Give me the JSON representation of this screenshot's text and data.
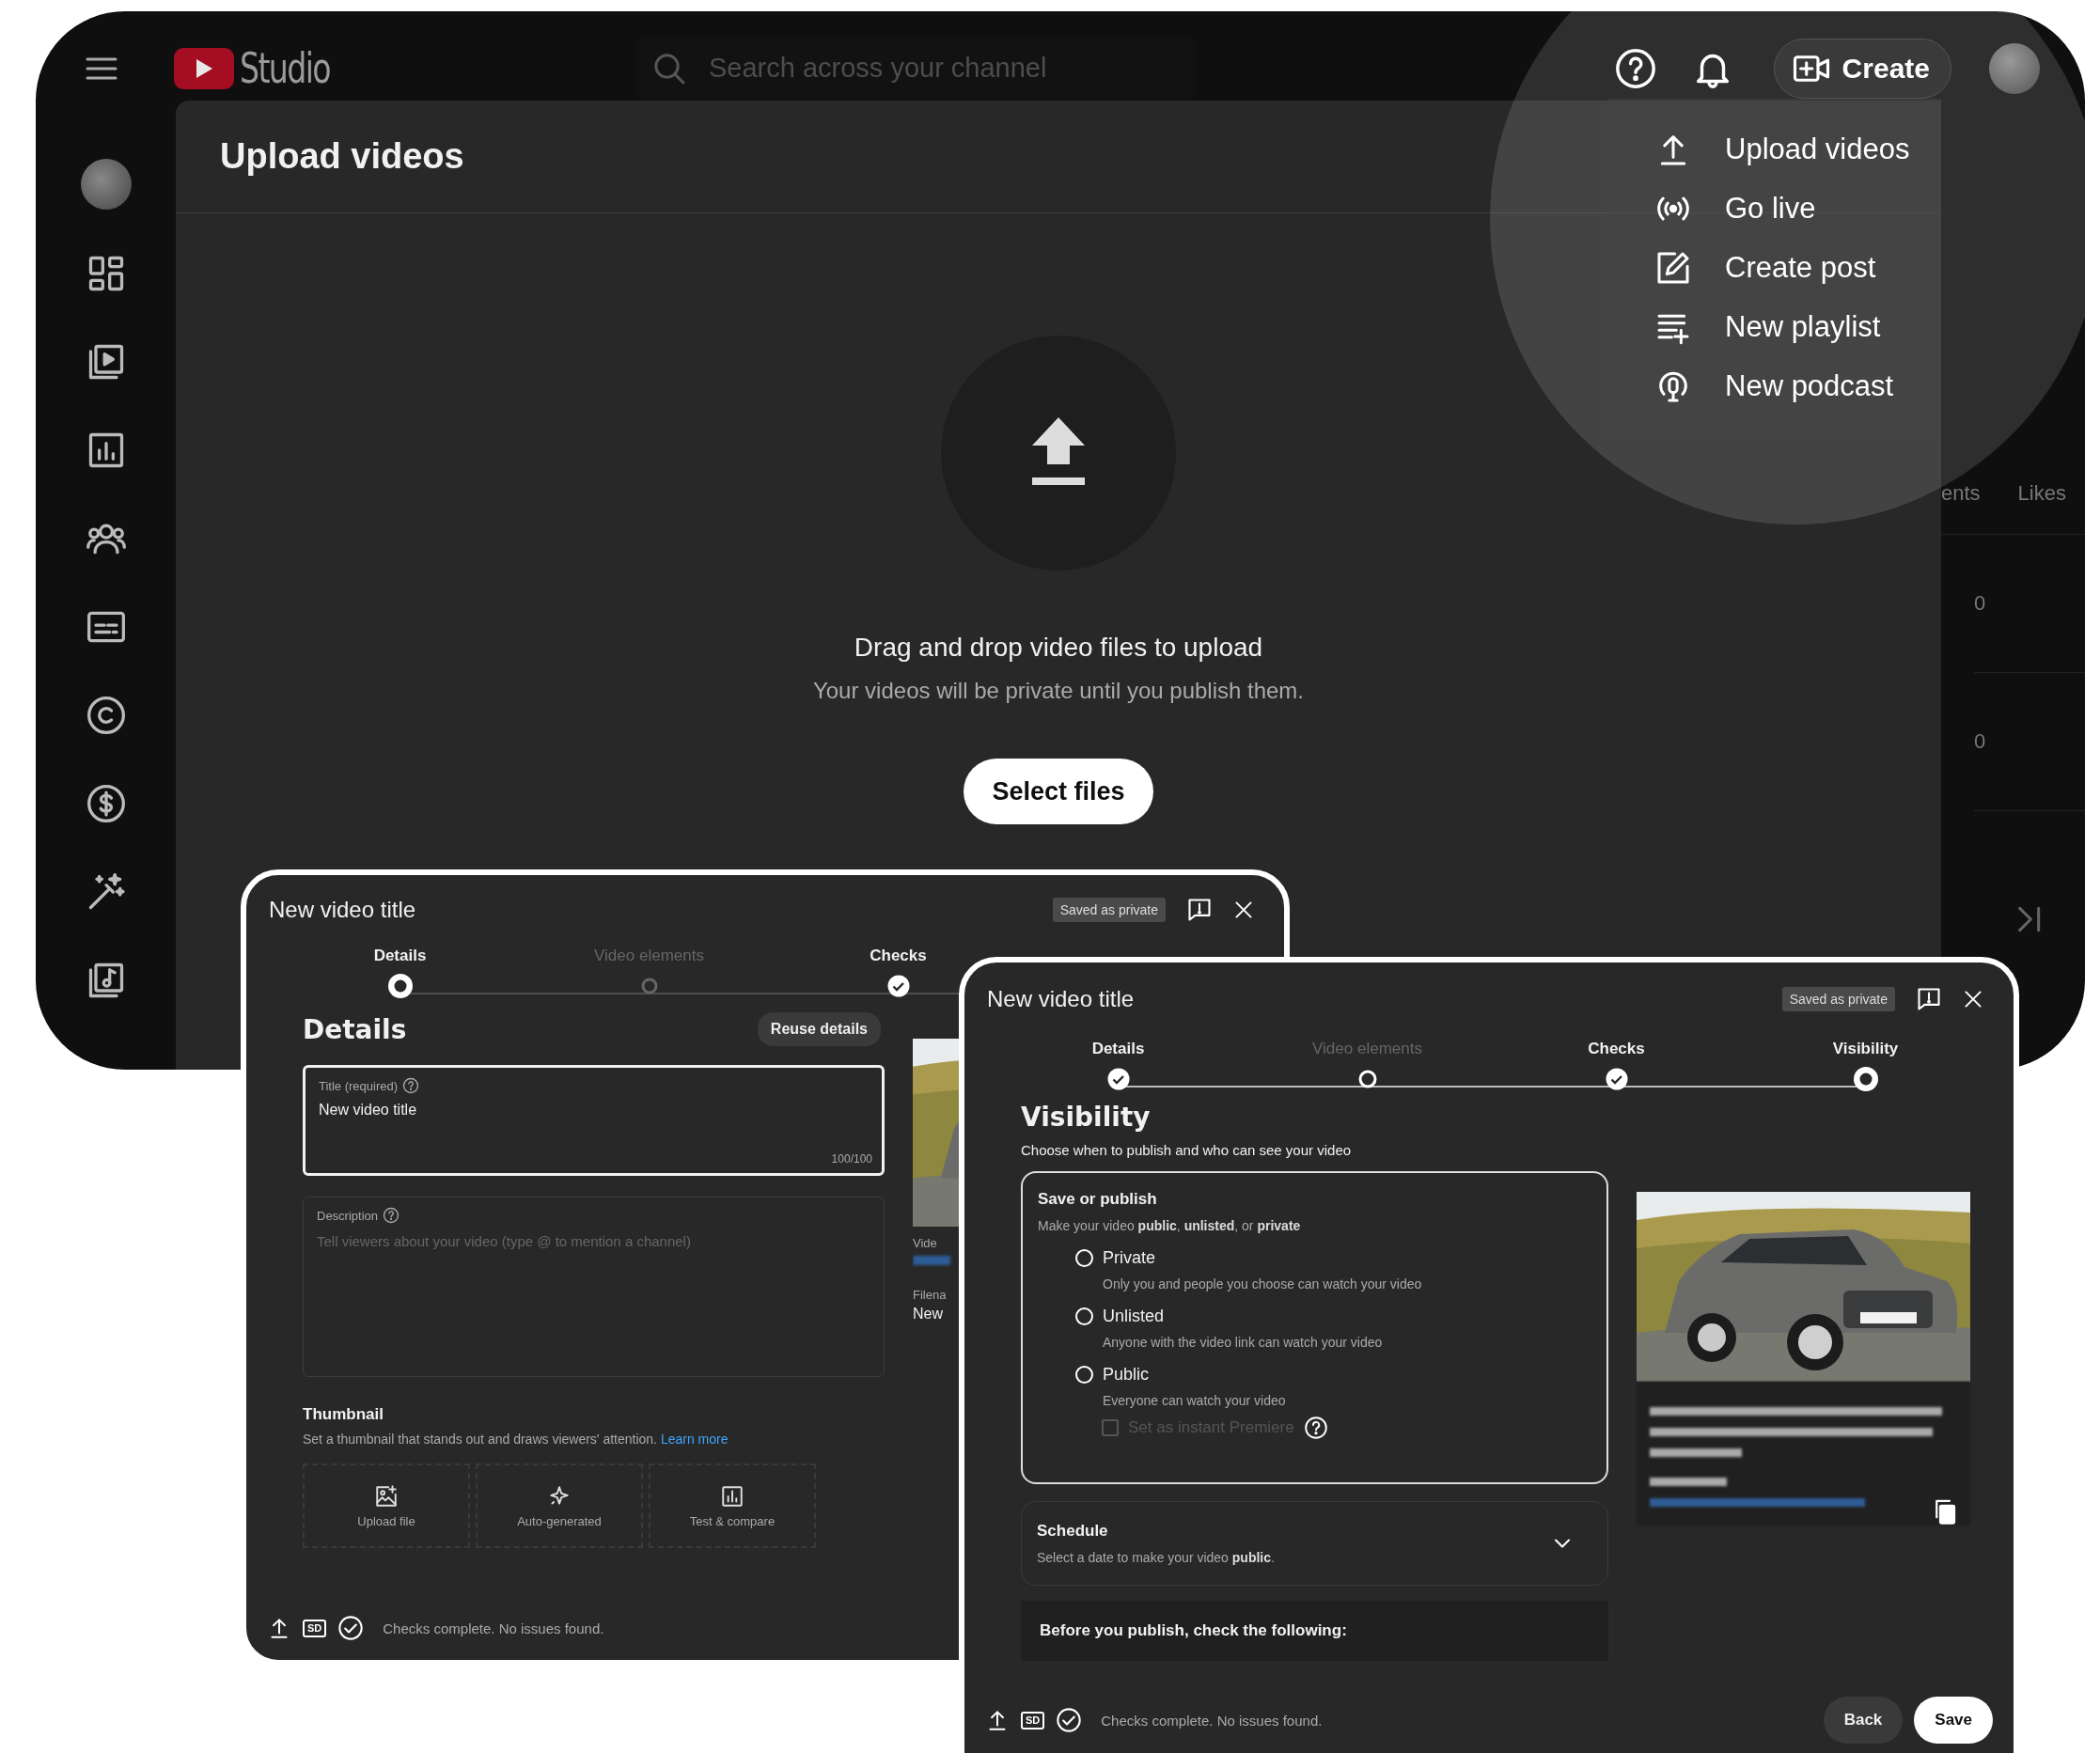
{
  "topbar": {
    "logo_text": "Studio",
    "search": {
      "placeholder": "Search across your channel"
    },
    "create_button": "Create"
  },
  "upload_panel": {
    "title": "Upload videos",
    "prompt": "Drag and drop video files to upload",
    "note": "Your videos will be private until you publish them.",
    "button": "Select files"
  },
  "background_table": {
    "headers": [
      "ents",
      "Likes"
    ],
    "cells": [
      "0",
      "0"
    ]
  },
  "create_menu": {
    "items": [
      {
        "label": "Upload videos"
      },
      {
        "label": "Go live"
      },
      {
        "label": "Create post"
      },
      {
        "label": "New playlist"
      },
      {
        "label": "New podcast"
      }
    ]
  },
  "dialogs": [
    {
      "kind": "details",
      "title": "New video title",
      "status_chip": "Saved as private",
      "steps": [
        {
          "label": "Details",
          "kind": "current",
          "disabled": false
        },
        {
          "label": "Video elements",
          "kind": "pending",
          "disabled": true
        },
        {
          "label": "Checks",
          "kind": "done",
          "disabled": false
        }
      ],
      "heading": "Details",
      "reuse_button": "Reuse details",
      "title_field": {
        "label": "Title (required)",
        "value": "New video title",
        "counter": "100/100"
      },
      "description_field": {
        "label": "Description",
        "placeholder": "Tell viewers about your video (type @ to mention a channel)"
      },
      "side_labels": [
        "Vide",
        "Filena"
      ],
      "side_value": "New",
      "thumbnail": {
        "title": "Thumbnail",
        "hint": "Set a thumbnail that stands out and draws viewers' attention.",
        "link": "Learn more",
        "options": [
          "Upload file",
          "Auto-generated",
          "Test & compare"
        ]
      },
      "footer": {
        "badge": "SD",
        "status": "Checks complete. No issues found."
      }
    },
    {
      "kind": "visibility",
      "title": "New video title",
      "status_chip": "Saved as private",
      "steps": [
        {
          "label": "Details",
          "kind": "done",
          "disabled": false
        },
        {
          "label": "Video elements",
          "kind": "visited",
          "disabled": true
        },
        {
          "label": "Checks",
          "kind": "done",
          "disabled": false
        },
        {
          "label": "Visibility",
          "kind": "current",
          "disabled": false
        }
      ],
      "heading": "Visibility",
      "subtitle": "Choose when to publish and who can see your video",
      "save_publish": {
        "title": "Save or publish",
        "hint": "Make your video **public**, **unlisted**, or **private**",
        "options": [
          {
            "label": "Private",
            "description": "Only you and people you choose can watch your video",
            "selected": false
          },
          {
            "label": "Unlisted",
            "description": "Anyone with the video link can watch your video",
            "selected": false
          },
          {
            "label": "Public",
            "description": "Everyone can watch your video",
            "selected": false
          }
        ],
        "premiere": {
          "label": "Set as instant Premiere",
          "checked": false,
          "disabled": true
        }
      },
      "schedule": {
        "title": "Schedule",
        "hint": "Select a date to make your video **public**.",
        "expanded": false
      },
      "checklist_title": "Before you publish, check the following:",
      "footer": {
        "badge": "SD",
        "status": "Checks complete. No issues found."
      },
      "buttons": [
        {
          "label": "Back",
          "kind": "secondary"
        },
        {
          "label": "Save",
          "kind": "primary"
        }
      ]
    }
  ]
}
